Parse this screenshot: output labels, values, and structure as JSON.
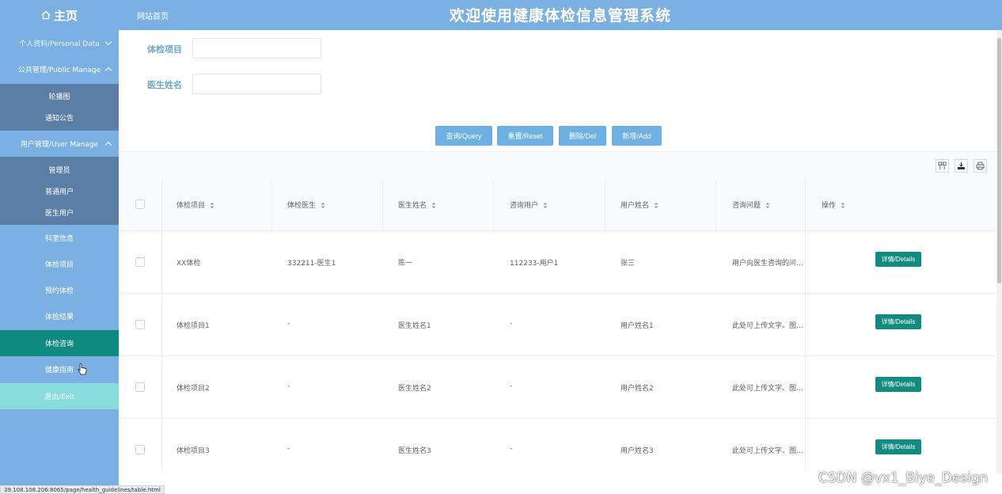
{
  "header": {
    "home_link": "网站首页",
    "title": "欢迎使用健康体检信息管理系统"
  },
  "sidebar": {
    "brand": "主页",
    "groups": [
      {
        "label": "个人资料/Personal Data",
        "expanded": false
      },
      {
        "label": "公共管理/Public Manage",
        "expanded": true,
        "items": [
          "轮播图",
          "通知公告"
        ]
      },
      {
        "label": "用户管理/User Manage",
        "expanded": true,
        "items": [
          "管理员",
          "普通用户",
          "医生用户"
        ]
      }
    ],
    "items": [
      "科室信息",
      "体检项目",
      "预约体检",
      "体检结果",
      "体检咨询",
      "健康指南"
    ],
    "active_item": "体检咨询",
    "exit": "退出/Exit"
  },
  "status_url": "39.108.108.206:8065/page/health_guidelines/table.html",
  "search": {
    "fields": [
      {
        "label": "体检项目",
        "value": "",
        "placeholder": ""
      },
      {
        "label": "医生姓名",
        "value": "",
        "placeholder": ""
      }
    ],
    "buttons": [
      "查询/Query",
      "重置/Reset",
      "删除/Del",
      "新增/Add"
    ]
  },
  "table": {
    "columns": [
      "体检项目",
      "体检医生",
      "医生姓名",
      "咨询用户",
      "用户姓名",
      "咨询问题",
      "操作"
    ],
    "rows": [
      [
        "XX体检",
        "332211-医生1",
        "陈一",
        "112233-用户1",
        "张三",
        "用户向医生咨询的问..."
      ],
      [
        "体检项目1",
        "-",
        "医生姓名1",
        "-",
        "用户姓名1",
        "此处可上传文字、图..."
      ],
      [
        "体检项目2",
        "-",
        "医生姓名2",
        "-",
        "用户姓名2",
        "此处可上传文字、图..."
      ],
      [
        "体检项目3",
        "-",
        "医生姓名3",
        "-",
        "用户姓名3",
        "此处可上传文字、图..."
      ]
    ],
    "action_label": "详情/Details"
  },
  "watermark": "CSDN @vx1_Biye_Design",
  "colors": {
    "header_bg": "#7bb0e3",
    "submenu_bg": "#5b7fa4",
    "active_bg": "#0f8a80",
    "exit_bg": "#88dcdc",
    "button_bg": "#6fb0e2",
    "detail_bg": "#138c80",
    "label_color": "#6fa9c9"
  }
}
